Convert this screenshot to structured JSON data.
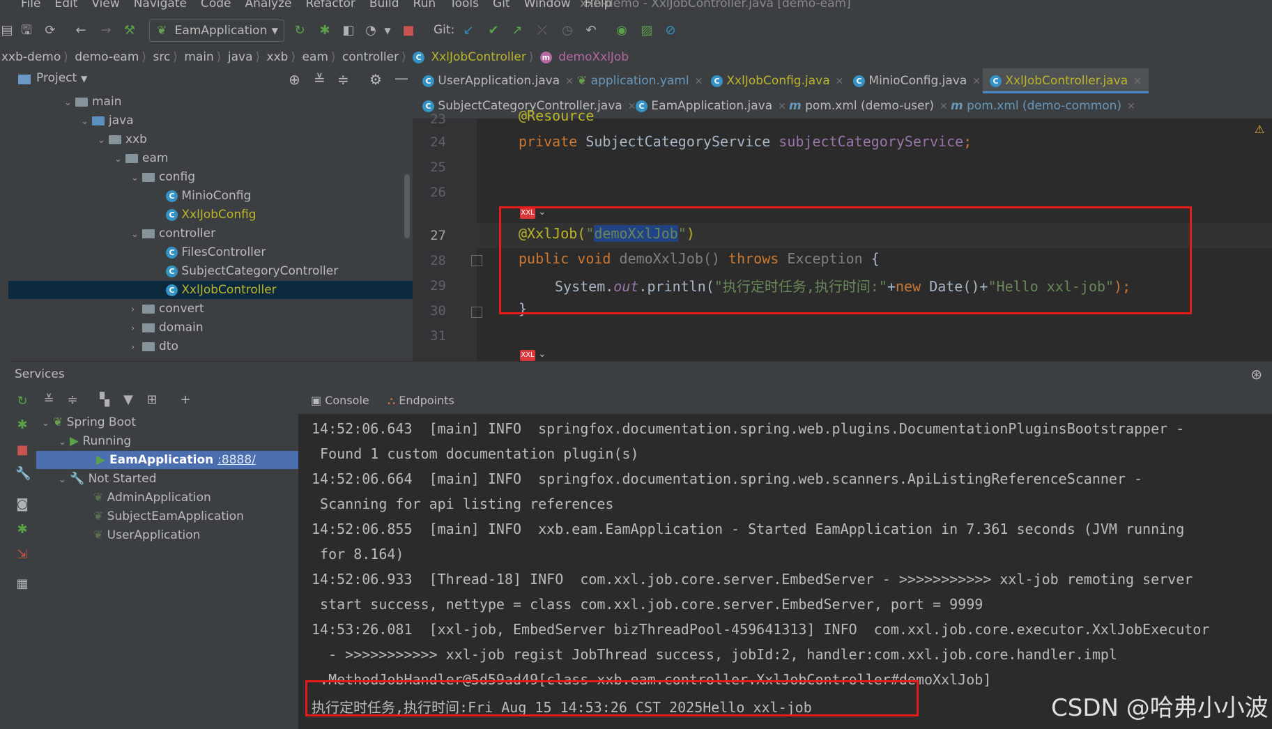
{
  "window": {
    "title": "xxb-demo - XxlJobController.java [demo-eam]"
  },
  "menu": [
    "File",
    "Edit",
    "View",
    "Navigate",
    "Code",
    "Analyze",
    "Refactor",
    "Build",
    "Run",
    "Tools",
    "Git",
    "Window",
    "Help"
  ],
  "toolbar": {
    "run_config": "EamApplication",
    "git_label": "Git:"
  },
  "breadcrumb": [
    "xxb-demo",
    "demo-eam",
    "src",
    "main",
    "java",
    "xxb",
    "eam",
    "controller",
    "XxlJobController",
    "demoXxlJob"
  ],
  "project_panel": {
    "title": "Project",
    "tree": [
      {
        "label": "main",
        "type": "folder",
        "expanded": true
      },
      {
        "label": "java",
        "type": "folder-blue",
        "expanded": true
      },
      {
        "label": "xxb",
        "type": "folder",
        "expanded": true
      },
      {
        "label": "eam",
        "type": "folder",
        "expanded": true
      },
      {
        "label": "config",
        "type": "folder",
        "expanded": true
      },
      {
        "label": "MinioConfig",
        "type": "class"
      },
      {
        "label": "XxlJobConfig",
        "type": "class",
        "modified": true
      },
      {
        "label": "controller",
        "type": "folder",
        "expanded": true
      },
      {
        "label": "FilesController",
        "type": "class"
      },
      {
        "label": "SubjectCategoryController",
        "type": "class"
      },
      {
        "label": "XxlJobController",
        "type": "class",
        "selected": true,
        "modified": true
      },
      {
        "label": "convert",
        "type": "folder",
        "expanded": false
      },
      {
        "label": "domain",
        "type": "folder",
        "expanded": false
      },
      {
        "label": "dto",
        "type": "folder",
        "expanded": false
      }
    ]
  },
  "editor_tabs": {
    "row1": [
      "UserApplication.java",
      "application.yaml",
      "XxlJobConfig.java",
      "MinioConfig.java",
      "XxlJobController.java"
    ],
    "row2": [
      "SubjectCategoryController.java",
      "EamApplication.java",
      "pom.xml (demo-user)",
      "pom.xml (demo-common)"
    ]
  },
  "code": {
    "line_numbers": [
      "23",
      "24",
      "25",
      "26",
      "27",
      "28",
      "29",
      "30",
      "31"
    ],
    "line23": "@Resource",
    "l24_kw": "private ",
    "l24_type": "SubjectCategoryService ",
    "l24_field": "subjectCategoryService",
    "l24_end": ";",
    "l27_ann": "@XxlJob(",
    "l27_q1": "\"",
    "l27_str": "demoXxlJob",
    "l27_q2": "\"",
    "l27_end": ")",
    "l28_kw": "public void ",
    "l28_name": "demoXxlJob() ",
    "l28_throws": "throws ",
    "l28_exc": "Exception ",
    "l28_end": "{",
    "l29_a": "System.",
    "l29_out": "out",
    "l29_b": ".println(",
    "l29_str1": "\"执行定时任务,执行时间:\"",
    "l29_plus1": "+",
    "l29_new": "new ",
    "l29_date": "Date()+",
    "l29_str2": "\"Hello xxl-job\"",
    "l29_end": ");",
    "l30": "}"
  },
  "services": {
    "title": "Services",
    "tree": [
      {
        "label": "Spring Boot"
      },
      {
        "label": "Running"
      },
      {
        "label": "EamApplication",
        "port": ":8888/",
        "selected": true
      },
      {
        "label": "Not Started"
      },
      {
        "label": "AdminApplication"
      },
      {
        "label": "SubjectEamApplication"
      },
      {
        "label": "UserApplication"
      }
    ],
    "tabs": [
      "Console",
      "Endpoints"
    ]
  },
  "console": {
    "lines": [
      "14:52:06.643  [main] INFO  springfox.documentation.spring.web.plugins.DocumentationPluginsBootstrapper -",
      " Found 1 custom documentation plugin(s)",
      "14:52:06.664  [main] INFO  springfox.documentation.spring.web.scanners.ApiListingReferenceScanner -",
      " Scanning for api listing references",
      "14:52:06.855  [main] INFO  xxb.eam.EamApplication - Started EamApplication in 7.361 seconds (JVM running",
      " for 8.164)",
      "14:52:06.933  [Thread-18] INFO  com.xxl.job.core.server.EmbedServer - >>>>>>>>>>> xxl-job remoting server",
      " start success, nettype = class com.xxl.job.core.server.EmbedServer, port = 9999",
      "14:53:26.081  [xxl-job, EmbedServer bizThreadPool-459641313] INFO  com.xxl.job.core.executor.XxlJobExecutor",
      "  - >>>>>>>>>>> xxl-job regist JobThread success, jobId:2, handler:com.xxl.job.core.handler.impl",
      " .MethodJobHandler@5d59ad49[class xxb.eam.controller.XxlJobController#demoXxlJob]",
      "执行定时任务,执行时间:Fri Aug 15 14:53:26 CST 2025Hello xxl-job"
    ]
  },
  "watermark": "CSDN @哈弗小小波",
  "colors": {
    "highlight_box": "#e31b1b",
    "selection": "#0d293e",
    "accent": "#4a88c7"
  }
}
